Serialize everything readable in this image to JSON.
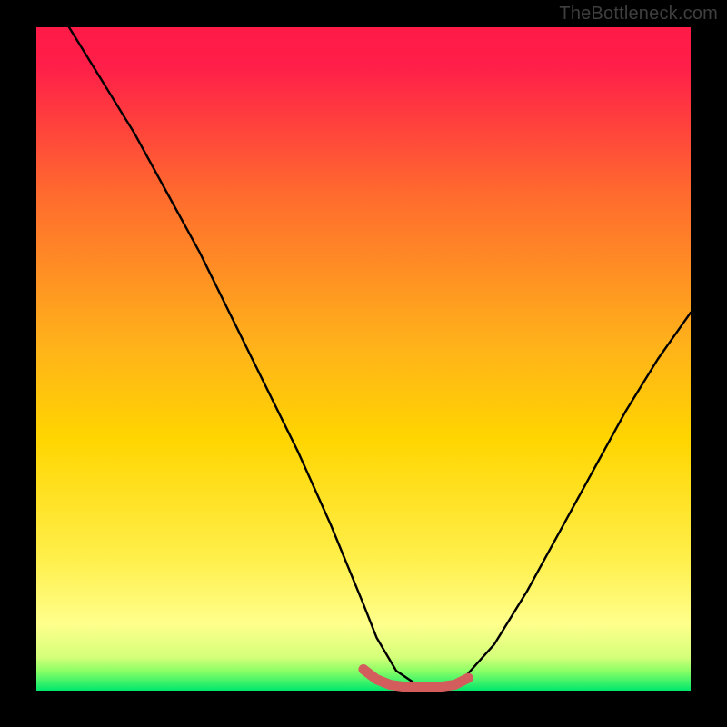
{
  "watermark": {
    "text": "TheBottleneck.com"
  },
  "colors": {
    "bg": "#000000",
    "curve": "#000000",
    "marker": "#d35d5d",
    "grad_top": "#ff1a47",
    "grad_mid": "#ffd500",
    "grad_low": "#ffff8c",
    "grad_bottom": "#00e86b"
  },
  "chart_data": {
    "type": "line",
    "title": "",
    "xlabel": "",
    "ylabel": "",
    "xlim": [
      0,
      100
    ],
    "ylim": [
      0,
      100
    ],
    "grid": false,
    "legend": false,
    "note": "V-shaped bottleneck curve; deep minimum ~x=55-65 on a red→yellow→green vertical gradient. Values are visual estimates.",
    "series": [
      {
        "name": "bottleneck-curve",
        "x": [
          5,
          10,
          15,
          20,
          25,
          30,
          35,
          40,
          45,
          50,
          52,
          55,
          58,
          60,
          62,
          65,
          70,
          75,
          80,
          85,
          90,
          95,
          100
        ],
        "y": [
          100,
          92,
          84,
          75,
          66,
          56,
          46,
          36,
          25,
          13,
          8,
          3,
          1,
          0.5,
          0.5,
          1.5,
          7,
          15,
          24,
          33,
          42,
          50,
          57
        ]
      },
      {
        "name": "optimal-range-marker",
        "x": [
          50,
          52,
          54,
          56,
          58,
          60,
          62,
          64,
          66
        ],
        "y": [
          3.2,
          1.7,
          0.9,
          0.6,
          0.55,
          0.55,
          0.6,
          0.9,
          1.9
        ]
      }
    ]
  }
}
